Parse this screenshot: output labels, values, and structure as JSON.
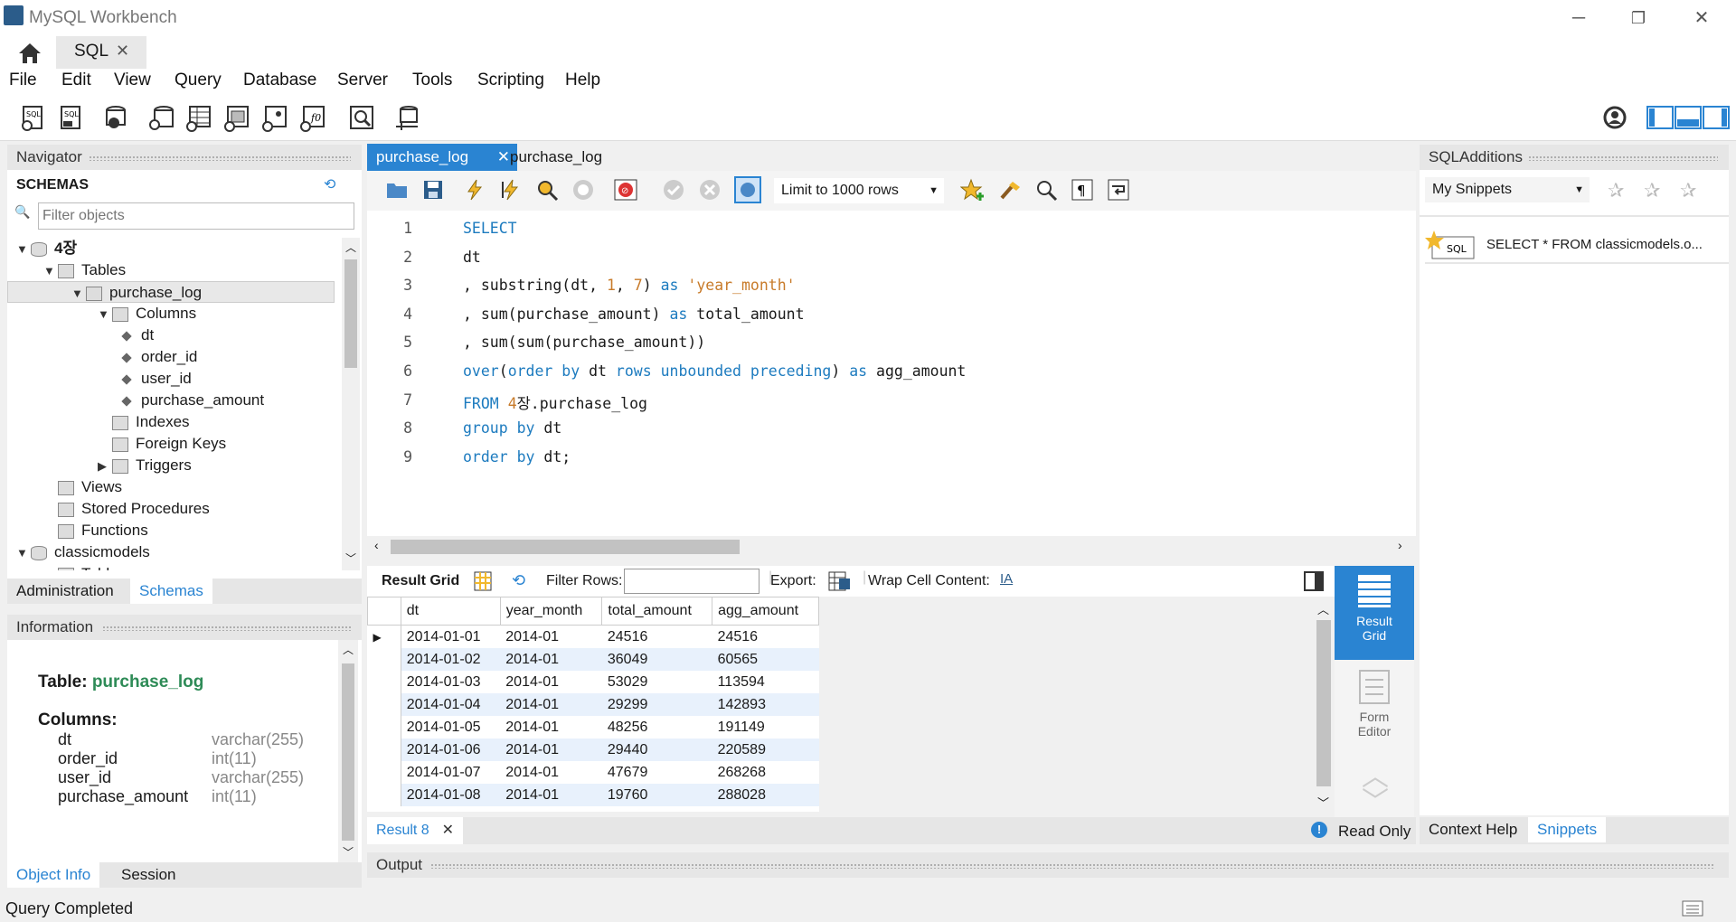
{
  "window": {
    "title": "MySQL Workbench"
  },
  "tabs": {
    "home_icon": "home-icon",
    "sql_tab": "SQL"
  },
  "menu": [
    "File",
    "Edit",
    "View",
    "Query",
    "Database",
    "Server",
    "Tools",
    "Scripting",
    "Help"
  ],
  "navigator": {
    "header": "Navigator",
    "schemas_title": "SCHEMAS",
    "filter_placeholder": "Filter objects",
    "tree": [
      {
        "label": "4장",
        "level": 0,
        "expander": "▼",
        "icon": "db"
      },
      {
        "label": "Tables",
        "level": 1,
        "expander": "▼",
        "icon": "folder"
      },
      {
        "label": "purchase_log",
        "level": 2,
        "expander": "▼",
        "icon": "table",
        "selected": true
      },
      {
        "label": "Columns",
        "level": 3,
        "expander": "▼",
        "icon": "folder"
      },
      {
        "label": "dt",
        "level": 4,
        "icon": "column"
      },
      {
        "label": "order_id",
        "level": 4,
        "icon": "column"
      },
      {
        "label": "user_id",
        "level": 4,
        "icon": "column"
      },
      {
        "label": "purchase_amount",
        "level": 4,
        "icon": "column"
      },
      {
        "label": "Indexes",
        "level": 3,
        "icon": "folder"
      },
      {
        "label": "Foreign Keys",
        "level": 3,
        "icon": "folder"
      },
      {
        "label": "Triggers",
        "level": 3,
        "expander": "▶",
        "icon": "folder"
      },
      {
        "label": "Views",
        "level": 1,
        "icon": "folder"
      },
      {
        "label": "Stored Procedures",
        "level": 1,
        "icon": "folder"
      },
      {
        "label": "Functions",
        "level": 1,
        "icon": "folder"
      },
      {
        "label": "classicmodels",
        "level": 0,
        "expander": "▼",
        "icon": "db"
      },
      {
        "label": "Tables",
        "level": 1,
        "expander": "▼",
        "icon": "folder"
      }
    ],
    "bottom_tabs": [
      "Administration",
      "Schemas"
    ],
    "active_tab": "Schemas"
  },
  "information": {
    "header": "Information",
    "table_label": "Table:",
    "table_name": "purchase_log",
    "columns_label": "Columns:",
    "columns": [
      {
        "name": "dt",
        "type": "varchar(255)"
      },
      {
        "name": "order_id",
        "type": "int(11)"
      },
      {
        "name": "user_id",
        "type": "varchar(255)"
      },
      {
        "name": "purchase_amount",
        "type": "int(11)"
      }
    ],
    "bottom_tabs": [
      "Object Info",
      "Session"
    ],
    "active_tab": "Object Info"
  },
  "editor": {
    "tabs": [
      "purchase_log",
      "purchase_log"
    ],
    "active_tab_index": 0,
    "limit_select": "Limit to 1000 rows",
    "lines": [
      [
        {
          "t": "SELECT",
          "c": "kw"
        }
      ],
      [
        {
          "t": "dt",
          "c": ""
        }
      ],
      [
        {
          "t": ", substring(dt, ",
          "c": ""
        },
        {
          "t": "1",
          "c": "num"
        },
        {
          "t": ", ",
          "c": ""
        },
        {
          "t": "7",
          "c": "num"
        },
        {
          "t": ") ",
          "c": ""
        },
        {
          "t": "as",
          "c": "kw"
        },
        {
          "t": " ",
          "c": ""
        },
        {
          "t": "'year_month'",
          "c": "str"
        }
      ],
      [
        {
          "t": ", sum(purchase_amount) ",
          "c": ""
        },
        {
          "t": "as",
          "c": "kw"
        },
        {
          "t": " total_amount",
          "c": ""
        }
      ],
      [
        {
          "t": ", sum(sum(purchase_amount))",
          "c": ""
        }
      ],
      [
        {
          "t": "over",
          "c": "kw"
        },
        {
          "t": "(",
          "c": ""
        },
        {
          "t": "order by",
          "c": "kw"
        },
        {
          "t": " dt ",
          "c": ""
        },
        {
          "t": "rows unbounded preceding",
          "c": "kw"
        },
        {
          "t": ") ",
          "c": ""
        },
        {
          "t": "as",
          "c": "kw"
        },
        {
          "t": " agg_amount",
          "c": ""
        }
      ],
      [
        {
          "t": "FROM",
          "c": "kw"
        },
        {
          "t": " ",
          "c": ""
        },
        {
          "t": "4",
          "c": "num"
        },
        {
          "t": "장.purchase_log",
          "c": ""
        }
      ],
      [
        {
          "t": "group by",
          "c": "kw"
        },
        {
          "t": " dt",
          "c": ""
        }
      ],
      [
        {
          "t": "order by",
          "c": "kw"
        },
        {
          "t": " dt;",
          "c": ""
        }
      ]
    ]
  },
  "result": {
    "toolbar": {
      "result_grid": "Result Grid",
      "filter_rows": "Filter Rows:",
      "export": "Export:",
      "wrap": "Wrap Cell Content:"
    },
    "columns": [
      "dt",
      "year_month",
      "total_amount",
      "agg_amount"
    ],
    "rows": [
      [
        "2014-01-01",
        "2014-01",
        "24516",
        "24516"
      ],
      [
        "2014-01-02",
        "2014-01",
        "36049",
        "60565"
      ],
      [
        "2014-01-03",
        "2014-01",
        "53029",
        "113594"
      ],
      [
        "2014-01-04",
        "2014-01",
        "29299",
        "142893"
      ],
      [
        "2014-01-05",
        "2014-01",
        "48256",
        "191149"
      ],
      [
        "2014-01-06",
        "2014-01",
        "29440",
        "220589"
      ],
      [
        "2014-01-07",
        "2014-01",
        "47679",
        "268268"
      ],
      [
        "2014-01-08",
        "2014-01",
        "19760",
        "288028"
      ]
    ],
    "side": {
      "result_grid": "Result\nGrid",
      "form_editor": "Form\nEditor"
    },
    "result_tab": "Result 8",
    "read_only": "Read Only"
  },
  "output": {
    "header": "Output"
  },
  "sql_additions": {
    "header": "SQLAdditions",
    "snippet_select": "My Snippets",
    "snippet_text": "SELECT * FROM classicmodels.o...",
    "bottom_tabs": [
      "Context Help",
      "Snippets"
    ],
    "active_tab": "Snippets"
  },
  "status": {
    "text": "Query Completed"
  },
  "colors": {
    "accent": "#2a84d2",
    "keyword": "#1d7bbf",
    "string": "#c87b2a",
    "table_name": "#2e8b57"
  }
}
